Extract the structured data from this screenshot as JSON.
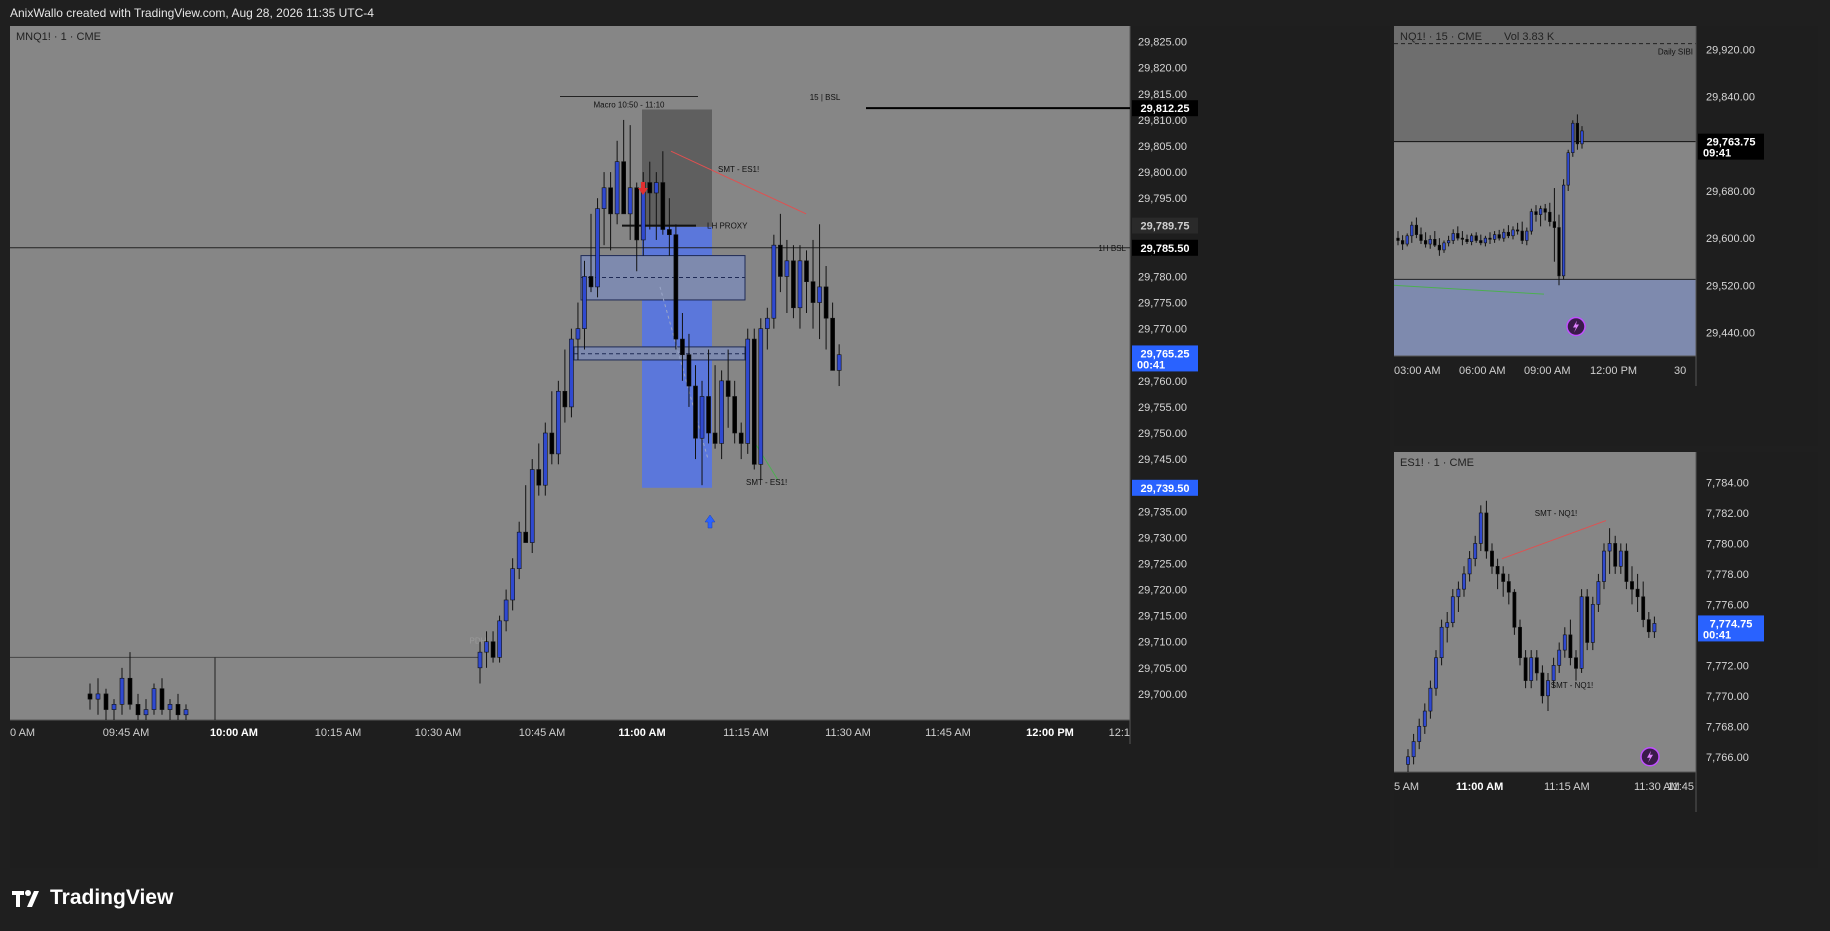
{
  "header": {
    "text": "AnixWallo created with TradingView.com, Aug 28, 2026 11:35 UTC-4"
  },
  "brand": {
    "name": "TradingView",
    "icon": "tradingview-logo-icon"
  },
  "colors": {
    "bull": "#2f49d0",
    "bear": "#000000",
    "pane": "#868686",
    "box": "#7e8aae",
    "grey_box": "#5f5f5f",
    "blue_box": "#5b77db",
    "price_label": "#2962ff",
    "smt_red": "#e05050",
    "smt_green": "#4caf50"
  },
  "chart_data": [
    {
      "type": "candlestick",
      "title": "MNQ1! · 1 · CME",
      "ylim": [
        29695,
        29828
      ],
      "y_ticks": [
        "29,825.00",
        "29,820.00",
        "29,815.00",
        "29,810.00",
        "29,805.00",
        "29,800.00",
        "29,795.00",
        "29,790.00",
        "29,785.00",
        "29,780.00",
        "29,775.00",
        "29,770.00",
        "29,765.00",
        "29,760.00",
        "29,755.00",
        "29,750.00",
        "29,745.00",
        "29,740.00",
        "29,735.00",
        "29,730.00",
        "29,725.00",
        "29,720.00",
        "29,715.00",
        "29,710.00",
        "29,705.00",
        "29,700.00"
      ],
      "x_ticks": [
        "0 AM",
        "09:45 AM",
        "10:00 AM",
        "10:15 AM",
        "10:30 AM",
        "10:45 AM",
        "11:00 AM",
        "11:15 AM",
        "11:30 AM",
        "11:45 AM",
        "12:00 PM",
        "12:1"
      ],
      "price_labels": [
        {
          "text": "29,812.25",
          "value": 29812.25,
          "style": "black"
        },
        {
          "text": "29,789.75",
          "value": 29789.75,
          "style": "grey"
        },
        {
          "text": "29,785.50",
          "value": 29785.5,
          "style": "black"
        },
        {
          "text": "29,765.25",
          "sub": "00:41",
          "value": 29765.25,
          "style": "blue"
        },
        {
          "text": "29,739.50",
          "value": 29739.5,
          "style": "blue"
        }
      ],
      "annotations": {
        "macro": "Macro 10:50 - 11:10",
        "bsl15": "15 | BSL",
        "smt_top": "SMT - ES1!",
        "lh_proxy": "LH PROXY",
        "bsl1h": "1H BSL",
        "smt_bottom": "SMT - ES1!",
        "pdh": "PDH"
      },
      "levels": {
        "bsl15": 29812.25,
        "bsl1h": 29785.5,
        "pdh": 29707
      },
      "candles": [
        [
          29700,
          29702,
          29697,
          29699
        ],
        [
          29699,
          29703,
          29696,
          29700
        ],
        [
          29700,
          29701,
          29695,
          29697
        ],
        [
          29697,
          29699,
          29695,
          29698
        ],
        [
          29698,
          29705,
          29696,
          29703
        ],
        [
          29703,
          29708,
          29697,
          29698
        ],
        [
          29698,
          29700,
          29695,
          29696
        ],
        [
          29696,
          29699,
          29695,
          29697
        ],
        [
          29697,
          29702,
          29696,
          29701
        ],
        [
          29701,
          29703,
          29696,
          29697
        ],
        [
          29697,
          29699,
          29695,
          29698
        ],
        [
          29698,
          29700,
          29695,
          29696
        ],
        [
          29696,
          29698,
          29695,
          29697
        ],
        [
          29705,
          29710,
          29702,
          29708
        ],
        [
          29708,
          29712,
          29705,
          29710
        ],
        [
          29710,
          29712,
          29706,
          29707
        ],
        [
          29707,
          29715,
          29706,
          29714
        ],
        [
          29714,
          29720,
          29712,
          29718
        ],
        [
          29718,
          29726,
          29716,
          29724
        ],
        [
          29724,
          29733,
          29722,
          29731
        ],
        [
          29731,
          29740,
          29729,
          29729
        ],
        [
          29729,
          29745,
          29727,
          29743
        ],
        [
          29743,
          29748,
          29738,
          29740
        ],
        [
          29740,
          29752,
          29738,
          29750
        ],
        [
          29750,
          29758,
          29744,
          29746
        ],
        [
          29746,
          29760,
          29744,
          29758
        ],
        [
          29758,
          29766,
          29752,
          29755
        ],
        [
          29755,
          29770,
          29753,
          29768
        ],
        [
          29768,
          29775,
          29764,
          29770
        ],
        [
          29770,
          29783,
          29766,
          29780
        ],
        [
          29780,
          29792,
          29777,
          29778
        ],
        [
          29778,
          29795,
          29776,
          29793
        ],
        [
          29793,
          29800,
          29786,
          29797
        ],
        [
          29797,
          29800,
          29785,
          29792
        ],
        [
          29792,
          29806,
          29790,
          29802
        ],
        [
          29802,
          29810,
          29798,
          29792
        ],
        [
          29792,
          29809,
          29787,
          29797
        ],
        [
          29797,
          29798,
          29781,
          29787
        ],
        [
          29787,
          29800,
          29784,
          29798
        ],
        [
          29798,
          29802,
          29789,
          29796
        ],
        [
          29796,
          29800,
          29787,
          29798
        ],
        [
          29798,
          29804,
          29788,
          29789
        ],
        [
          29789,
          29795,
          29784,
          29788
        ],
        [
          29788,
          29790,
          29766,
          29768
        ],
        [
          29768,
          29773,
          29760,
          29765
        ],
        [
          29765,
          29769,
          29755,
          29759
        ],
        [
          29759,
          29763,
          29745,
          29749
        ],
        [
          29749,
          29760,
          29740,
          29757
        ],
        [
          29757,
          29766,
          29748,
          29750
        ],
        [
          29750,
          29763,
          29747,
          29748
        ],
        [
          29748,
          29762,
          29745,
          29760
        ],
        [
          29760,
          29766,
          29751,
          29757
        ],
        [
          29757,
          29760,
          29748,
          29750
        ],
        [
          29750,
          29752,
          29745,
          29748
        ],
        [
          29748,
          29770,
          29746,
          29768
        ],
        [
          29768,
          29770,
          29743,
          29744
        ],
        [
          29744,
          29772,
          29741,
          29770
        ],
        [
          29770,
          29774,
          29766,
          29772
        ],
        [
          29772,
          29788,
          29770,
          29786
        ],
        [
          29786,
          29792,
          29777,
          29780
        ],
        [
          29780,
          29787,
          29773,
          29783
        ],
        [
          29783,
          29786,
          29772,
          29774
        ],
        [
          29774,
          29786,
          29770,
          29783
        ],
        [
          29783,
          29785,
          29773,
          29779
        ],
        [
          29779,
          29787,
          29770,
          29775
        ],
        [
          29775,
          29790,
          29768,
          29778
        ],
        [
          29778,
          29782,
          29766,
          29772
        ],
        [
          29772,
          29775,
          29762,
          29762
        ],
        [
          29762,
          29767,
          29759,
          29765
        ]
      ]
    },
    {
      "type": "candlestick",
      "title": "NQ1! · 15 · CME",
      "volume": "Vol 3.83 K",
      "ylim": [
        29400,
        29960
      ],
      "y_ticks": [
        "29,920.00",
        "29,840.00",
        "29,760.00",
        "29,680.00",
        "29,600.00",
        "29,520.00",
        "29,440.00"
      ],
      "x_ticks": [
        "03:00 AM",
        "06:00 AM",
        "09:00 AM",
        "12:00 PM",
        "30"
      ],
      "price_label": {
        "text": "29,763.75",
        "sub": "09:41",
        "value": 29763.75
      },
      "daily_label": "Daily SIBI",
      "daily_level": 29930,
      "candles": [
        [
          29600,
          29612,
          29588,
          29596
        ],
        [
          29596,
          29605,
          29580,
          29590
        ],
        [
          29590,
          29608,
          29586,
          29604
        ],
        [
          29604,
          29628,
          29592,
          29622
        ],
        [
          29622,
          29635,
          29600,
          29606
        ],
        [
          29606,
          29618,
          29590,
          29596
        ],
        [
          29596,
          29610,
          29584,
          29590
        ],
        [
          29590,
          29605,
          29582,
          29598
        ],
        [
          29598,
          29612,
          29585,
          29588
        ],
        [
          29588,
          29600,
          29570,
          29580
        ],
        [
          29580,
          29596,
          29575,
          29592
        ],
        [
          29592,
          29604,
          29586,
          29596
        ],
        [
          29596,
          29615,
          29590,
          29608
        ],
        [
          29608,
          29620,
          29596,
          29600
        ],
        [
          29600,
          29612,
          29588,
          29598
        ],
        [
          29598,
          29606,
          29590,
          29594
        ],
        [
          29594,
          29608,
          29588,
          29604
        ],
        [
          29604,
          29610,
          29592,
          29596
        ],
        [
          29596,
          29606,
          29588,
          29592
        ],
        [
          29592,
          29604,
          29586,
          29600
        ],
        [
          29600,
          29610,
          29590,
          29598
        ],
        [
          29598,
          29612,
          29592,
          29606
        ],
        [
          29606,
          29614,
          29596,
          29600
        ],
        [
          29600,
          29616,
          29594,
          29610
        ],
        [
          29610,
          29622,
          29600,
          29604
        ],
        [
          29604,
          29620,
          29598,
          29614
        ],
        [
          29614,
          29626,
          29606,
          29612
        ],
        [
          29612,
          29628,
          29590,
          29596
        ],
        [
          29596,
          29618,
          29588,
          29612
        ],
        [
          29612,
          29650,
          29606,
          29645
        ],
        [
          29645,
          29656,
          29628,
          29640
        ],
        [
          29640,
          29655,
          29620,
          29650
        ],
        [
          29650,
          29658,
          29630,
          29644
        ],
        [
          29644,
          29660,
          29620,
          29628
        ],
        [
          29628,
          29685,
          29560,
          29618
        ],
        [
          29618,
          29640,
          29520,
          29536
        ],
        [
          29536,
          29700,
          29530,
          29690
        ],
        [
          29690,
          29750,
          29680,
          29745
        ],
        [
          29745,
          29800,
          29738,
          29795
        ],
        [
          29795,
          29810,
          29750,
          29760
        ],
        [
          29760,
          29790,
          29752,
          29782
        ]
      ]
    },
    {
      "type": "candlestick",
      "title": "ES1! · 1 · CME",
      "ylim": [
        7765,
        7786
      ],
      "y_ticks": [
        "7,784.00",
        "7,782.00",
        "7,780.00",
        "7,778.00",
        "7,776.00",
        "7,774.00",
        "7,772.00",
        "7,770.00",
        "7,768.00",
        "7,766.00"
      ],
      "x_ticks": [
        "5 AM",
        "11:00 AM",
        "11:15 AM",
        "11:30 AM",
        "11:45"
      ],
      "price_label": {
        "text": "7,774.75",
        "sub": "00:41",
        "value": 7774.75
      },
      "annotations": {
        "smt_top": "SMT - NQ1!",
        "smt_bottom": "SMT - NQ1!"
      },
      "candles": [
        [
          7765.5,
          7766.5,
          7765,
          7766
        ],
        [
          7766,
          7767.5,
          7765.5,
          7767
        ],
        [
          7767,
          7768.5,
          7766.5,
          7768
        ],
        [
          7768,
          7769.5,
          7767.5,
          7769
        ],
        [
          7769,
          7771,
          7768.5,
          7770.5
        ],
        [
          7770.5,
          7773,
          7770,
          7772.5
        ],
        [
          7772.5,
          7775,
          7772,
          7774.5
        ],
        [
          7774.5,
          7775.5,
          7773.5,
          7774.8
        ],
        [
          7774.8,
          7777,
          7774.5,
          7776.5
        ],
        [
          7776.5,
          7777.5,
          7775.5,
          7777
        ],
        [
          7777,
          7778.5,
          7776.5,
          7778
        ],
        [
          7778,
          7779.5,
          7777.5,
          7779
        ],
        [
          7779,
          7780.5,
          7778.5,
          7780
        ],
        [
          7780,
          7782.5,
          7779.5,
          7782
        ],
        [
          7782,
          7782.8,
          7779,
          7779.5
        ],
        [
          7779.5,
          7780,
          7778,
          7778.5
        ],
        [
          7778.5,
          7779,
          7777,
          7778
        ],
        [
          7778,
          7778.5,
          7776.5,
          7777.5
        ],
        [
          7777.5,
          7778,
          7776,
          7776.8
        ],
        [
          7776.8,
          7777,
          7774,
          7774.5
        ],
        [
          7774.5,
          7775,
          7772,
          7772.5
        ],
        [
          7772.5,
          7773,
          7770.5,
          7771
        ],
        [
          7771,
          7773,
          7770.5,
          7772.5
        ],
        [
          7772.5,
          7773,
          7771,
          7771.5
        ],
        [
          7771.5,
          7772,
          7769.5,
          7770
        ],
        [
          7770,
          7771.5,
          7769,
          7771
        ],
        [
          7771,
          7772.5,
          7770.5,
          7772
        ],
        [
          7772,
          7773.5,
          7771.5,
          7773
        ],
        [
          7773,
          7774.5,
          7772.5,
          7774
        ],
        [
          7774,
          7775,
          7772,
          7772.5
        ],
        [
          7772.5,
          7773,
          7771,
          7771.8
        ],
        [
          7771.8,
          7777,
          7771.5,
          7776.5
        ],
        [
          7776.5,
          7777,
          7773,
          7773.5
        ],
        [
          7773.5,
          7776.5,
          7773,
          7776
        ],
        [
          7776,
          7778,
          7775.5,
          7777.5
        ],
        [
          7777.5,
          7780,
          7777,
          7779.5
        ],
        [
          7779.5,
          7781,
          7778,
          7780
        ],
        [
          7780,
          7780.5,
          7778,
          7778.5
        ],
        [
          7778.5,
          7780,
          7778,
          7779.5
        ],
        [
          7779.5,
          7780,
          7777,
          7777.5
        ],
        [
          7777.5,
          7778.5,
          7776,
          7777
        ],
        [
          7777,
          7778,
          7775.5,
          7776.5
        ],
        [
          7776.5,
          7777.5,
          7774.5,
          7775
        ],
        [
          7775,
          7775.5,
          7773.8,
          7774.2
        ],
        [
          7774.2,
          7775.2,
          7773.8,
          7774.75
        ]
      ]
    }
  ]
}
